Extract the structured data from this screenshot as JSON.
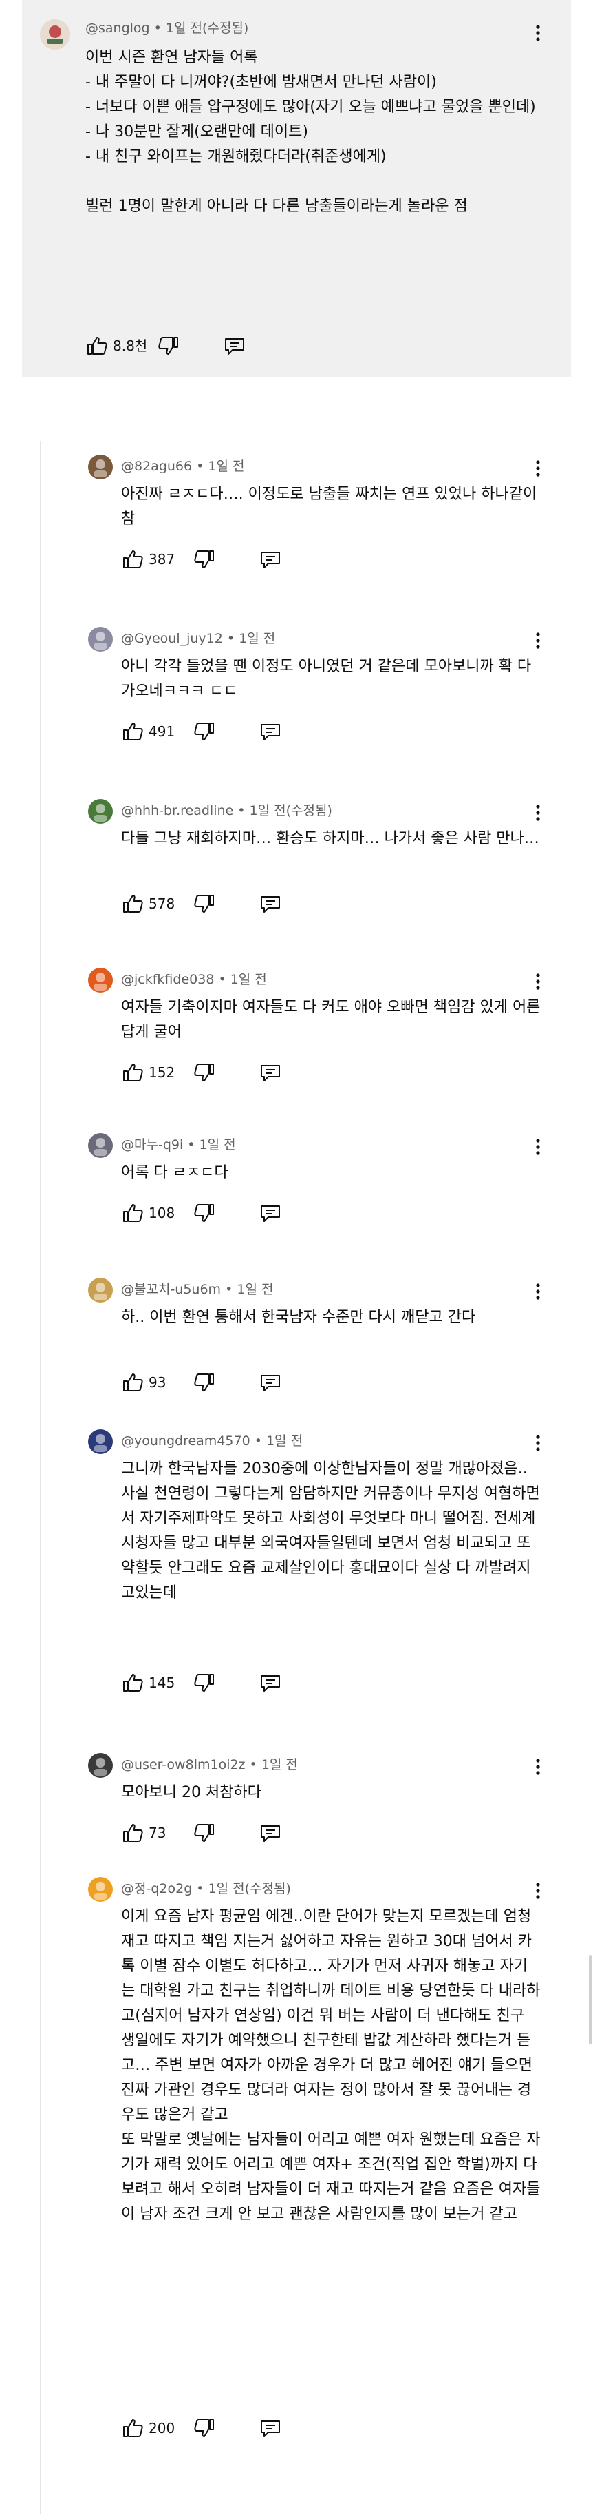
{
  "top_comment": {
    "handle": "@sanglog",
    "time": "1일 전(수정됨)",
    "text": "이번 시즌 환연 남자들 어록\n- 내 주말이 다 니꺼야?(초반에 밤새면서 만나던 사람이)\n- 너보다 이쁜 애들 압구정에도 많아(자기 오늘 예쁘냐고 물었을 뿐인데)\n- 나 30분만 잘게(오랜만에 데이트)\n- 내 친구 와이프는 개원해줬다더라(취준생에게)\n\n빌런 1명이 말한게 아니라 다 다른 남출들이라는게 놀라운 점",
    "likes": "8.8천"
  },
  "replies": [
    {
      "handle": "@82agu66",
      "time": "1일 전",
      "text": "아진짜 ㄹㅈㄷ다…. 이정도로 남출들 짜치는 연프 있었나 하나같이 참",
      "likes": "387",
      "avatar_color": "#7a5a3a"
    },
    {
      "handle": "@Gyeoul_juy12",
      "time": "1일 전",
      "text": "아니 각각 들었을 땐 이정도 아니였던 거 같은데 모아보니까 확 다가오네ㅋㅋㅋ ㄷㄷ",
      "likes": "491",
      "avatar_color": "#8a8aa0"
    },
    {
      "handle": "@hhh-br.readline",
      "time": "1일 전(수정됨)",
      "text": "다들 그냥 재회하지마… 환승도 하지마… 나가서 좋은 사람 만나…",
      "likes": "578",
      "avatar_color": "#4a7a3a"
    },
    {
      "handle": "@jckfkfide038",
      "time": "1일 전",
      "text": "여자들 기축이지마 여자들도 다 커도 애야 오빠면 책임감 있게 어른답게 굴어",
      "likes": "152",
      "avatar_color": "#e25a1c"
    },
    {
      "handle": "@마누-q9i",
      "time": "1일 전",
      "text": "어록 다 ㄹㅈㄷ다",
      "likes": "108",
      "avatar_color": "#6a6a7a"
    },
    {
      "handle": "@불꼬치-u5u6m",
      "time": "1일 전",
      "text": "하.. 이번 환연 통해서 한국남자 수준만 다시 깨닫고 간다",
      "likes": "93",
      "avatar_color": "#c8a050"
    },
    {
      "handle": "@youngdream4570",
      "time": "1일 전",
      "text": "그니까 한국남자들 2030중에 이상한남자들이 정말 개많아졌음.. 사실 천연령이 그렇다는게 암담하지만 커뮤충이나 무지성 여혐하면서 자기주제파악도 못하고 사회성이 무엇보다 마니 떨어짐. 전세계 시청자들 많고 대부분 외국여자들일텐데 보면서 엄청 비교되고 또약할듯 안그래도 요즘 교제살인이다 홍대묘이다 실상 다 까발려지고있는데",
      "likes": "145",
      "avatar_color": "#2a3a7a"
    },
    {
      "handle": "@user-ow8lm1oi2z",
      "time": "1일 전",
      "text": "모아보니 20 처참하다",
      "likes": "73",
      "avatar_color": "#3a3a3a"
    },
    {
      "handle": "@정-q2o2g",
      "time": "1일 전(수정됨)",
      "text": "이게 요즘 남자 평균임 에겐..이란 단어가 맞는지 모르겠는데 엄청 재고 따지고 책임 지는거 싫어하고 자유는 원하고 30대 넘어서 카톡 이별 잠수 이별도 허다하고… 자기가 먼저 사귀자 해놓고 자기는 대학원 가고 친구는 취업하니까 데이트 비용 당연한듯 다 내라하고(심지어 남자가 연상임) 이건 뭐 버는 사람이 더 낸다해도 친구 생일에도 자기가 예약했으니 친구한테 밥값 계산하라 했다는거 듣고… 주변 보면 여자가 아까운 경우가 더 많고 헤어진 얘기 들으면 진짜 가관인 경우도 많더라 여자는 정이 많아서 잘 못 끊어내는 경우도 많은거 같고\n또 막말로 옛날에는 남자들이 어리고 예쁜 여자 원했는데 요즘은 자기가 재력 있어도 어리고 예쁜 여자+ 조건(직업 집안 학벌)까지 다 보려고 해서 오히려 남자들이 더 재고 따지는거 같음 요즘은 여자들이 남자 조건 크게 안 보고 괜찮은 사람인지를 많이 보는거 같고",
      "likes": "200",
      "avatar_color": "#f0a020"
    }
  ]
}
